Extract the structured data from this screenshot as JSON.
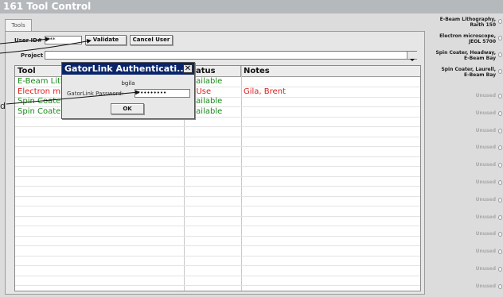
{
  "app": {
    "title": "161 Tool Control"
  },
  "tabs": [
    {
      "label": "Tools"
    }
  ],
  "user_form": {
    "user_label": "User ID#",
    "user_value": "***",
    "validate_label": "Validate",
    "cancel_label": "Cancel User",
    "project_label": "Project",
    "project_value": ""
  },
  "table": {
    "columns": [
      "Tool",
      "Status",
      "Notes"
    ],
    "rows": [
      {
        "tool": "E-Beam Lithography, Raith 150",
        "status": "Available",
        "notes": "",
        "color": "#1a8a1a"
      },
      {
        "tool": "Electron microscope, JEOL 5700",
        "status": "In Use",
        "notes": "Gila, Brent",
        "color": "#e01b1b"
      },
      {
        "tool": "Spin Coater, Headway, E-Beam Bay",
        "status": "Available",
        "notes": "",
        "color": "#1a8a1a"
      },
      {
        "tool": "Spin Coater, Laurell, E-Beam Bay",
        "status": "Available",
        "notes": "",
        "color": "#1a8a1a"
      }
    ]
  },
  "dialog": {
    "title": "GatorLink Authenticati...",
    "close": "✕",
    "username": "bgila",
    "password_label": "GatorLink Password:",
    "password_value": "•••••••••",
    "ok_label": "OK"
  },
  "sidebar": {
    "tools": [
      {
        "l1": "E-Beam Lithography,",
        "l2": "Raith 150"
      },
      {
        "l1": "Electron microscope,",
        "l2": "JEOL 5700"
      },
      {
        "l1": "Spin Coater, Headway,",
        "l2": "E-Beam Bay"
      },
      {
        "l1": "Spin Coater, Laurell,",
        "l2": "E-Beam Bay"
      }
    ],
    "unused": [
      "Unused",
      "Unused",
      "Unused",
      "Unused",
      "Unused",
      "Unused",
      "Unused",
      "Unused",
      "Unused",
      "Unused",
      "Unused",
      "Unused"
    ]
  },
  "margin": {
    "text": "d"
  },
  "colors": {
    "accent": "#0a246a",
    "available": "#1a8a1a",
    "in_use": "#e01b1b",
    "title_bg": "#b6b9bc"
  }
}
